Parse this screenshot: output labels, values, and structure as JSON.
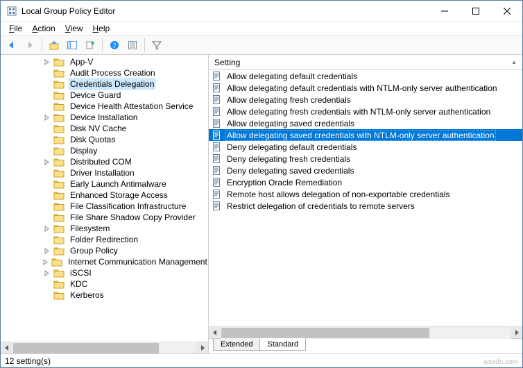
{
  "window": {
    "title": "Local Group Policy Editor"
  },
  "menu": {
    "file": "File",
    "action": "Action",
    "view": "View",
    "help": "Help"
  },
  "list": {
    "header": "Setting",
    "items": [
      "Allow delegating default credentials",
      "Allow delegating default credentials with NTLM-only server authentication",
      "Allow delegating fresh credentials",
      "Allow delegating fresh credentials with NTLM-only server authentication",
      "Allow delegating saved credentials",
      "Allow delegating saved credentials with NTLM-only server authentication",
      "Deny delegating default credentials",
      "Deny delegating fresh credentials",
      "Deny delegating saved credentials",
      "Encryption Oracle Remediation",
      "Remote host allows delegation of non-exportable credentials",
      "Restrict delegation of credentials to remote servers"
    ],
    "selected_index": 5
  },
  "tree": {
    "items": [
      {
        "label": "App-V",
        "expandable": true
      },
      {
        "label": "Audit Process Creation",
        "expandable": false
      },
      {
        "label": "Credentials Delegation",
        "expandable": false,
        "selected": true
      },
      {
        "label": "Device Guard",
        "expandable": false
      },
      {
        "label": "Device Health Attestation Service",
        "expandable": false
      },
      {
        "label": "Device Installation",
        "expandable": true
      },
      {
        "label": "Disk NV Cache",
        "expandable": false
      },
      {
        "label": "Disk Quotas",
        "expandable": false
      },
      {
        "label": "Display",
        "expandable": false
      },
      {
        "label": "Distributed COM",
        "expandable": true
      },
      {
        "label": "Driver Installation",
        "expandable": false
      },
      {
        "label": "Early Launch Antimalware",
        "expandable": false
      },
      {
        "label": "Enhanced Storage Access",
        "expandable": false
      },
      {
        "label": "File Classification Infrastructure",
        "expandable": false
      },
      {
        "label": "File Share Shadow Copy Provider",
        "expandable": false
      },
      {
        "label": "Filesystem",
        "expandable": true
      },
      {
        "label": "Folder Redirection",
        "expandable": false
      },
      {
        "label": "Group Policy",
        "expandable": true
      },
      {
        "label": "Internet Communication Management",
        "expandable": true
      },
      {
        "label": "iSCSI",
        "expandable": true
      },
      {
        "label": "KDC",
        "expandable": false
      },
      {
        "label": "Kerberos",
        "expandable": false
      }
    ]
  },
  "tabs": {
    "extended": "Extended",
    "standard": "Standard"
  },
  "status": {
    "text": "12 setting(s)"
  },
  "watermark": "wsxdn.com"
}
